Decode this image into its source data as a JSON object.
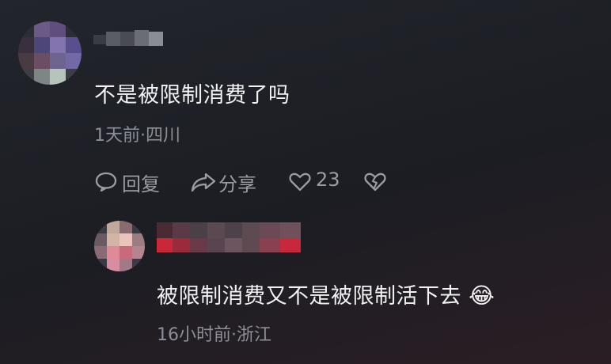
{
  "comments": [
    {
      "text": "不是被限制消费了吗",
      "meta": "1天前·四川",
      "actions": {
        "reply_label": "回复",
        "share_label": "分享",
        "like_count": "23"
      }
    }
  ],
  "reply": {
    "text": "被限制消费又不是被限制活下去",
    "emoji": "😂",
    "meta": "16小时前·浙江"
  },
  "icons": {
    "reply": "speech-bubble-icon",
    "share": "share-arrow-icon",
    "like": "heart-outline-icon",
    "dislike": "broken-heart-icon"
  },
  "colors": {
    "text_primary": "#f1f1f3",
    "text_secondary": "#8d8f98",
    "name_blur_accent": "#c8283a"
  }
}
